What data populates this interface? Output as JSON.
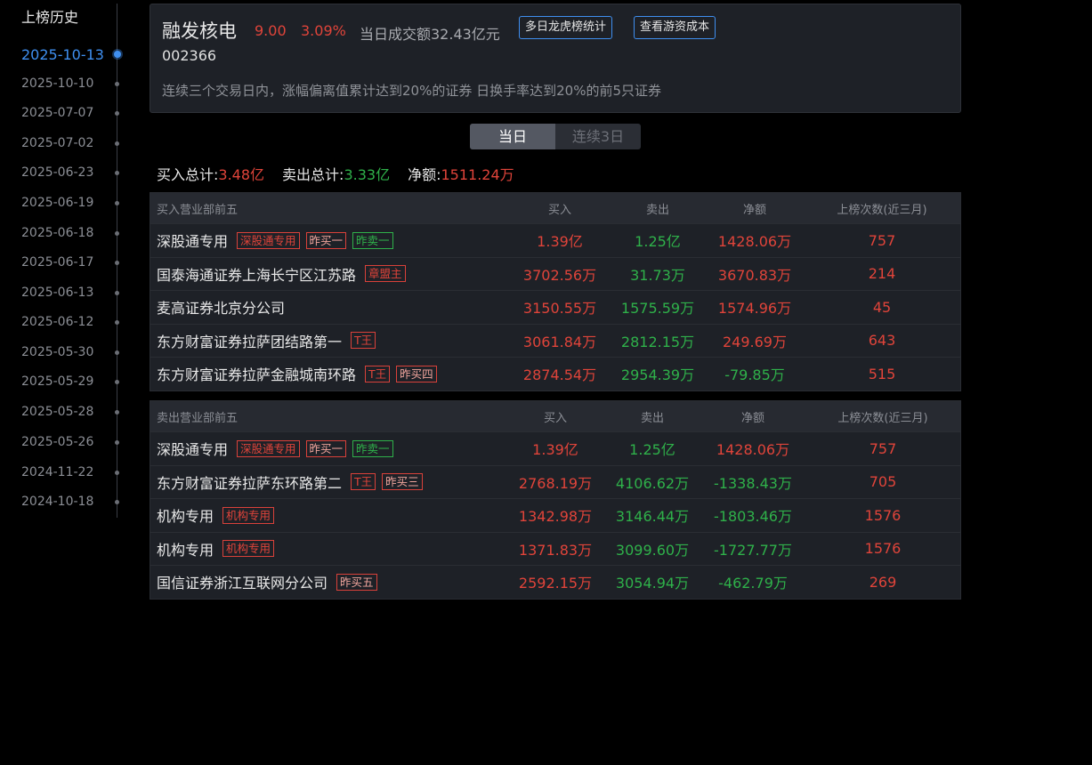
{
  "sidebar": {
    "title": "上榜历史",
    "dates": [
      "2025-10-13",
      "2025-10-10",
      "2025-07-07",
      "2025-07-02",
      "2025-06-23",
      "2025-06-19",
      "2025-06-18",
      "2025-06-17",
      "2025-06-13",
      "2025-06-12",
      "2025-05-30",
      "2025-05-29",
      "2025-05-28",
      "2025-05-26",
      "2024-11-22",
      "2024-10-18"
    ],
    "active_index": 0
  },
  "header": {
    "name": "融发核电",
    "price": "9.00",
    "change": "3.09%",
    "turnover": "当日成交额32.43亿元",
    "code": "002366",
    "btn_multi": "多日龙虎榜统计",
    "btn_cost": "查看游资成本",
    "reason": "连续三个交易日内，涨幅偏离值累计达到20%的证券 日换手率达到20%的前5只证券"
  },
  "toggle": {
    "today": "当日",
    "three_days": "连续3日"
  },
  "summary": {
    "buy_label": "买入总计:",
    "buy_value": "3.48亿",
    "sell_label": "卖出总计:",
    "sell_value": "3.33亿",
    "net_label": "净额:",
    "net_value": "1511.24万"
  },
  "buy_table": {
    "headers": {
      "name": "买入营业部前五",
      "buy": "买入",
      "sell": "卖出",
      "net": "净额",
      "count": "上榜次数(近三月)"
    },
    "rows": [
      {
        "name": "深股通专用",
        "buy": "1.39亿",
        "sell": "1.25亿",
        "net": "1428.06万",
        "count": "757",
        "tags": [
          {
            "text": "深股通专用",
            "style": "red"
          },
          {
            "text": "昨买一",
            "style": "salmon"
          },
          {
            "text": "昨卖一",
            "style": "green"
          }
        ]
      },
      {
        "name": "国泰海通证券上海长宁区江苏路",
        "buy": "3702.56万",
        "sell": "31.73万",
        "net": "3670.83万",
        "count": "214",
        "tags": [
          {
            "text": "章盟主",
            "style": "red"
          }
        ]
      },
      {
        "name": "麦高证券北京分公司",
        "buy": "3150.55万",
        "sell": "1575.59万",
        "net": "1574.96万",
        "count": "45",
        "tags": []
      },
      {
        "name": "东方财富证券拉萨团结路第一",
        "buy": "3061.84万",
        "sell": "2812.15万",
        "net": "249.69万",
        "count": "643",
        "tags": [
          {
            "text": "T王",
            "style": "red"
          }
        ]
      },
      {
        "name": "东方财富证券拉萨金融城南环路",
        "buy": "2874.54万",
        "sell": "2954.39万",
        "net": "-79.85万",
        "count": "515",
        "tags": [
          {
            "text": "T王",
            "style": "red"
          },
          {
            "text": "昨买四",
            "style": "salmon"
          }
        ]
      }
    ]
  },
  "sell_table": {
    "headers": {
      "name": "卖出营业部前五",
      "buy": "买入",
      "sell": "卖出",
      "net": "净额",
      "count": "上榜次数(近三月)"
    },
    "rows": [
      {
        "name": "深股通专用",
        "buy": "1.39亿",
        "sell": "1.25亿",
        "net": "1428.06万",
        "count": "757",
        "tags": [
          {
            "text": "深股通专用",
            "style": "red"
          },
          {
            "text": "昨买一",
            "style": "salmon"
          },
          {
            "text": "昨卖一",
            "style": "green"
          }
        ]
      },
      {
        "name": "东方财富证券拉萨东环路第二",
        "buy": "2768.19万",
        "sell": "4106.62万",
        "net": "-1338.43万",
        "count": "705",
        "tags": [
          {
            "text": "T王",
            "style": "red"
          },
          {
            "text": "昨买三",
            "style": "salmon"
          }
        ]
      },
      {
        "name": "机构专用",
        "buy": "1342.98万",
        "sell": "3146.44万",
        "net": "-1803.46万",
        "count": "1576",
        "tags": [
          {
            "text": "机构专用",
            "style": "red"
          }
        ]
      },
      {
        "name": "机构专用",
        "buy": "1371.83万",
        "sell": "3099.60万",
        "net": "-1727.77万",
        "count": "1576",
        "tags": [
          {
            "text": "机构专用",
            "style": "red"
          }
        ]
      },
      {
        "name": "国信证券浙江互联网分公司",
        "buy": "2592.15万",
        "sell": "3054.94万",
        "net": "-462.79万",
        "count": "269",
        "tags": [
          {
            "text": "昨买五",
            "style": "salmon"
          }
        ]
      }
    ]
  },
  "colors": {
    "up": "#e0443a",
    "down": "#2fb14a",
    "accent": "#3f8ff0"
  }
}
